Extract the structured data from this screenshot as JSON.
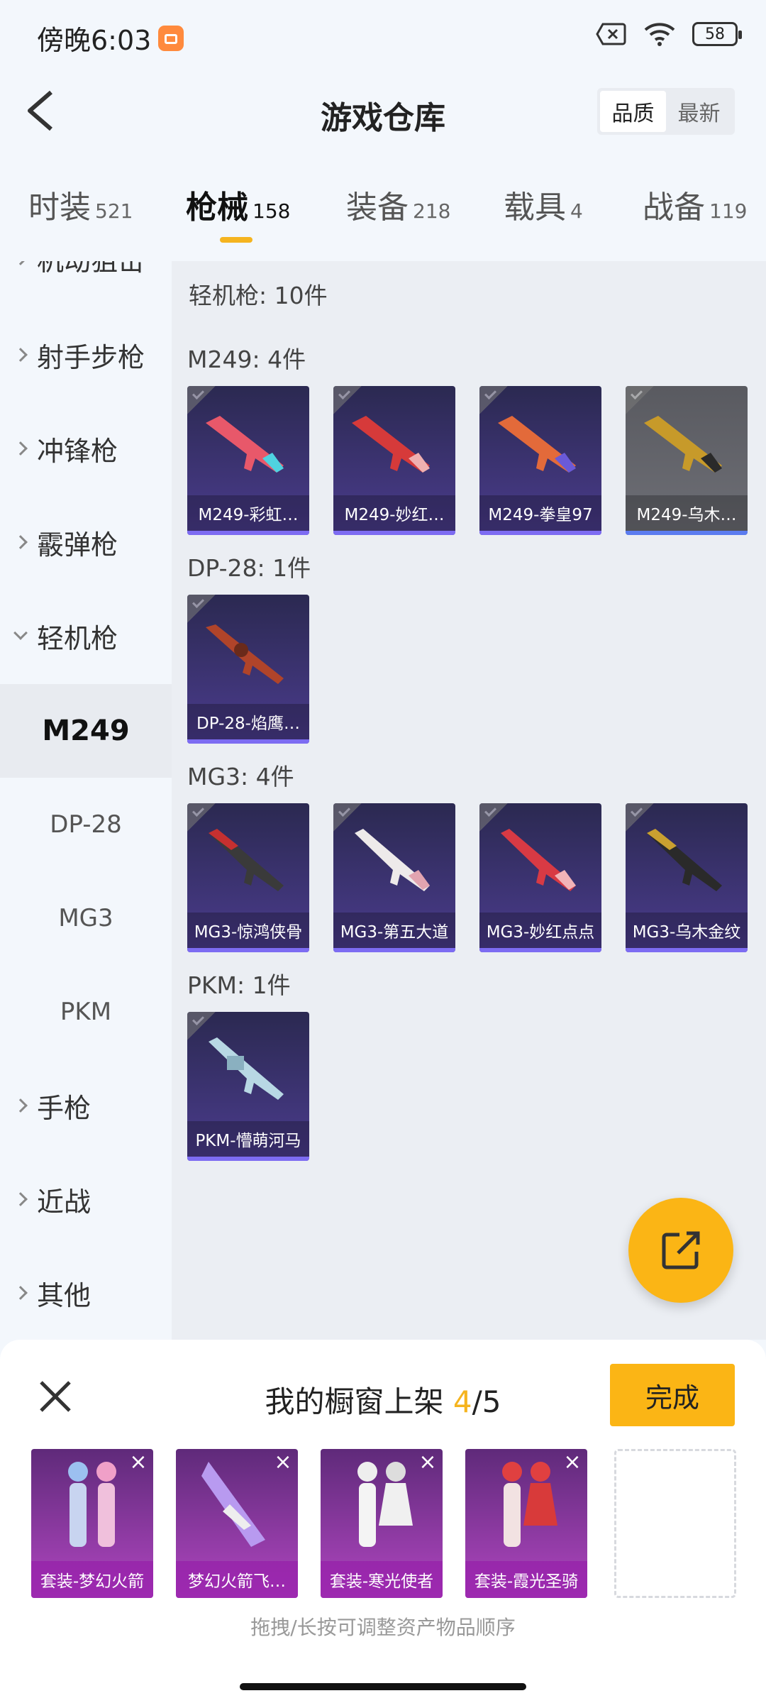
{
  "status": {
    "time": "傍晚6:03",
    "battery": "58"
  },
  "header": {
    "title": "游戏仓库",
    "sort_options": [
      "品质",
      "最新"
    ],
    "sort_active": "品质"
  },
  "tabs": [
    {
      "label": "时装",
      "count": "521"
    },
    {
      "label": "枪械",
      "count": "158",
      "active": true
    },
    {
      "label": "装备",
      "count": "218"
    },
    {
      "label": "载具",
      "count": "4"
    },
    {
      "label": "战备",
      "count": "119"
    }
  ],
  "sidebar": {
    "items": [
      "机动狙击",
      "射手步枪",
      "冲锋枪",
      "霰弹枪",
      "轻机枪"
    ],
    "sub_items": [
      "M249",
      "DP-28",
      "MG3",
      "PKM"
    ],
    "selected_sub": "M249",
    "more_items": [
      "手枪",
      "近战",
      "其他"
    ]
  },
  "content": {
    "category_title": "轻机枪: 10件",
    "groups": [
      {
        "title": "M249: 4件",
        "items": [
          "M249-彩虹…",
          "M249-妙红…",
          "M249-拳皇97",
          "M249-乌木…"
        ]
      },
      {
        "title": "DP-28: 1件",
        "items": [
          "DP-28-焰鹰…"
        ]
      },
      {
        "title": "MG3: 4件",
        "items": [
          "MG3-惊鸿侠骨",
          "MG3-第五大道",
          "MG3-妙红点点",
          "MG3-乌木金纹"
        ]
      },
      {
        "title": "PKM: 1件",
        "items": [
          "PKM-懵萌河马"
        ]
      }
    ]
  },
  "sheet": {
    "title_prefix": "我的橱窗上架 ",
    "count_current": "4",
    "count_total": "/5",
    "done_label": "完成",
    "items": [
      "套装-梦幻火箭",
      "梦幻火箭飞…",
      "套装-寒光使者",
      "套装-霞光圣骑"
    ],
    "hint": "拖拽/长按可调整资产物品顺序"
  },
  "colors": {
    "accent": "#fbb515",
    "card_purple": "#4b3c8e",
    "card_gray": "#6e6f76",
    "showcase_pink": "#b046c0"
  }
}
